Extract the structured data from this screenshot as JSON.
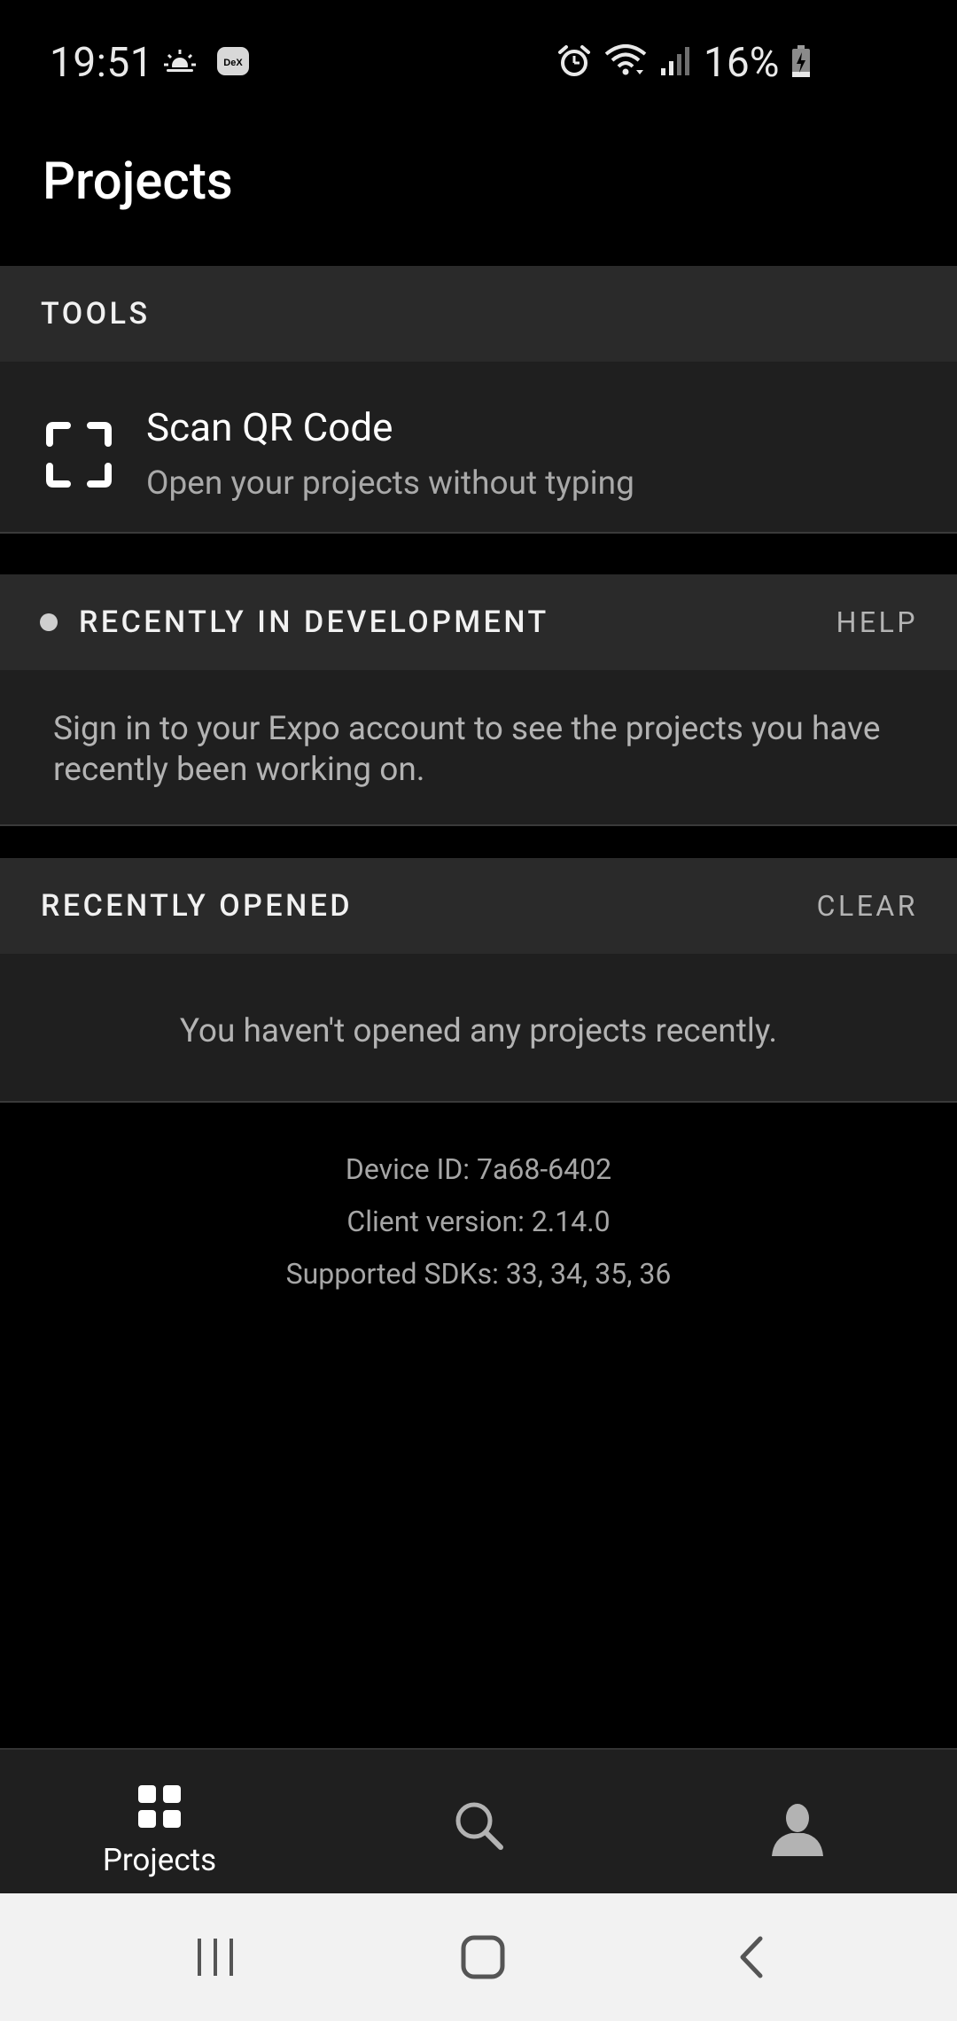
{
  "status_bar": {
    "time": "19:51",
    "battery_percent": "16%",
    "icons_left": [
      "weather-icon",
      "dex-icon"
    ],
    "icons_right": [
      "alarm-icon",
      "wifi-icon",
      "signal-icon",
      "battery-charging-icon"
    ],
    "dex_label": "DeX"
  },
  "header": {
    "title": "Projects"
  },
  "tools": {
    "section_title": "TOOLS",
    "scan_qr": {
      "title": "Scan QR Code",
      "subtitle": "Open your projects without typing"
    }
  },
  "recent_dev": {
    "section_title": "RECENTLY IN DEVELOPMENT",
    "action": "HELP",
    "message": "Sign in to your Expo account to see the projects you have recently been working on."
  },
  "recent_opened": {
    "section_title": "RECENTLY OPENED",
    "action": "CLEAR",
    "message": "You haven't opened any projects recently."
  },
  "device_info": {
    "device_id": "Device ID: 7a68-6402",
    "client_version": "Client version: 2.14.0",
    "supported_sdks": "Supported SDKs: 33, 34, 35, 36"
  },
  "tab_bar": {
    "tabs": [
      {
        "label": "Projects",
        "icon": "grid-icon",
        "active": true
      },
      {
        "label": "",
        "icon": "search-icon",
        "active": false
      },
      {
        "label": "",
        "icon": "profile-icon",
        "active": false
      }
    ]
  },
  "nav_bar": {
    "buttons": [
      "recents-icon",
      "home-icon",
      "back-icon"
    ]
  },
  "colors": {
    "background": "#000000",
    "section_header": "#2a2a2a",
    "section_body": "#1f1f1f",
    "text_primary": "#ffffff",
    "text_secondary": "#b3b3b3",
    "nav_bar": "#f2f2f2"
  }
}
